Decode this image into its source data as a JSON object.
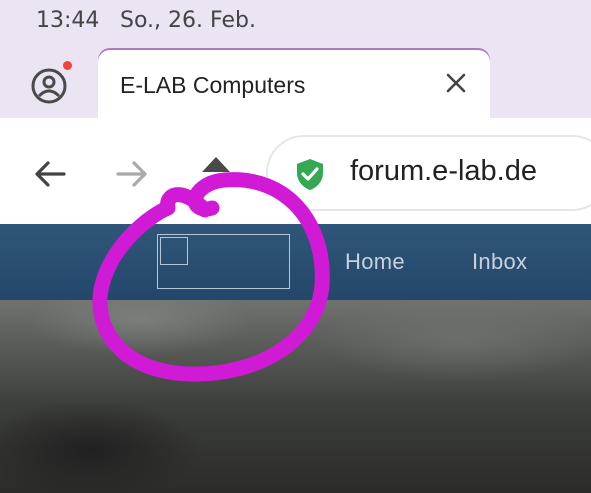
{
  "status_bar": {
    "time": "13:44",
    "date": "So., 26. Feb."
  },
  "tab": {
    "title": "E-LAB Computers"
  },
  "toolbar": {
    "url": "forum.e-lab.de"
  },
  "site_nav": {
    "links": [
      {
        "label": "Home"
      },
      {
        "label": "Inbox"
      }
    ]
  },
  "colors": {
    "annotation": "#d01ad6",
    "nav_background": "#2a4e72",
    "secure_shield": "#34a853",
    "notification_dot": "#f0443a"
  },
  "icons": [
    "account-circle-icon",
    "close-icon",
    "back-arrow-icon",
    "forward-arrow-icon",
    "home-icon",
    "secure-shield-icon"
  ]
}
